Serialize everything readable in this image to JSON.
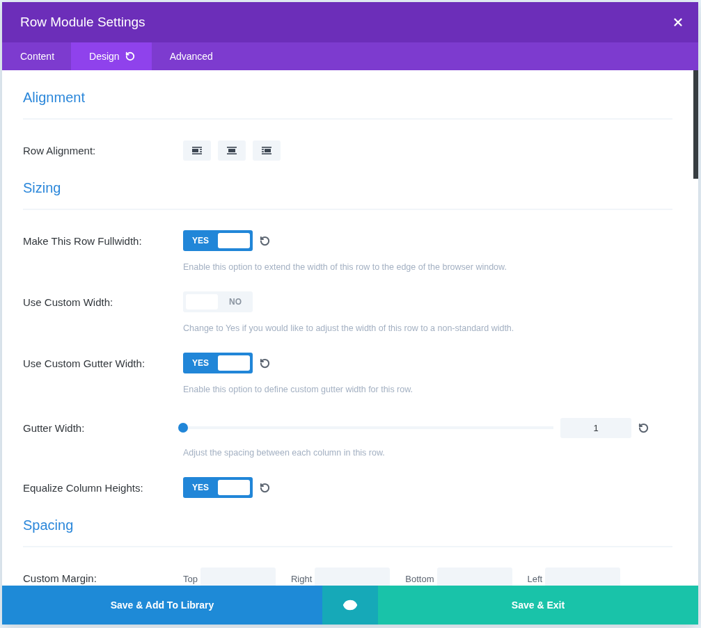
{
  "window": {
    "title": "Row Module Settings"
  },
  "tabs": [
    {
      "label": "Content",
      "selected": false,
      "modified": false
    },
    {
      "label": "Design",
      "selected": true,
      "modified": true
    },
    {
      "label": "Advanced",
      "selected": false,
      "modified": false
    }
  ],
  "sections": [
    {
      "title": "Alignment",
      "settings": [
        {
          "kind": "alignment",
          "label": "Row Alignment:"
        }
      ]
    },
    {
      "title": "Sizing",
      "settings": [
        {
          "kind": "toggle",
          "label": "Make This Row Fullwidth:",
          "on": true,
          "text": "YES",
          "modified": true,
          "description": "Enable this option to extend the width of this row to the edge of the browser window."
        },
        {
          "kind": "toggle",
          "label": "Use Custom Width:",
          "on": false,
          "text": "NO",
          "modified": false,
          "description": "Change to Yes if you would like to adjust the width of this row to a non-standard width."
        },
        {
          "kind": "toggle",
          "label": "Use Custom Gutter Width:",
          "on": true,
          "text": "YES",
          "modified": true,
          "description": "Enable this option to define custom gutter width for this row."
        },
        {
          "kind": "slider",
          "label": "Gutter Width:",
          "level": 0,
          "value": "1",
          "modified": true,
          "description": "Adjust the spacing between each column in this row."
        },
        {
          "kind": "toggle",
          "label": "Equalize Column Heights:",
          "on": true,
          "text": "YES",
          "modified": true
        }
      ]
    },
    {
      "title": "Spacing",
      "settings": [
        {
          "kind": "margin",
          "label": "Custom Margin:",
          "fields": [
            "Top",
            "Right",
            "Bottom",
            "Left"
          ]
        }
      ]
    }
  ],
  "footer": {
    "library_button": "Save & Add To Library",
    "exit_button": "Save & Exit"
  }
}
